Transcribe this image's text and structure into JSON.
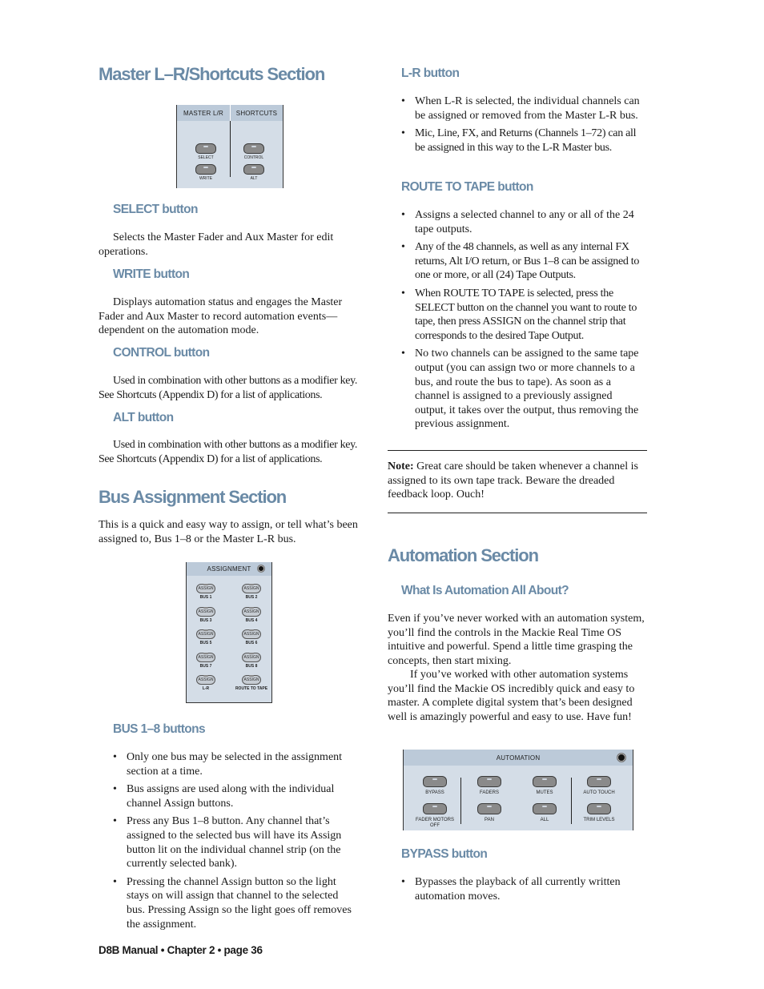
{
  "left": {
    "master_section": {
      "title": "Master L–R/Shortcuts Section",
      "panel": {
        "headers": [
          "MASTER L/R",
          "SHORTCUTS"
        ],
        "buttons": [
          "SELECT",
          "CONTROL",
          "WRITE",
          "ALT"
        ]
      },
      "subsections": [
        {
          "heading": "SELECT button",
          "text": "Selects the Master Fader and Aux Master for edit operations."
        },
        {
          "heading": "WRITE button",
          "text": "Displays automation status and engages the Master Fader and Aux Master to record automation events—dependent on the automation mode."
        },
        {
          "heading": "CONTROL button",
          "text": "Used in combination with other buttons as a modifier key. See Shortcuts (Appendix D) for a list of applications."
        },
        {
          "heading": "ALT button",
          "text": "Used in combination with other buttons as a modifier key. See Shortcuts (Appendix D) for a list of applications."
        }
      ]
    },
    "bus_section": {
      "title": "Bus Assignment Section",
      "intro": "This is a quick and easy way to assign, or tell what’s been assigned to, Bus 1–8 or the Master L-R bus.",
      "panel": {
        "header": "ASSIGNMENT",
        "button_text": "ASSIGN",
        "labels": [
          "BUS 1",
          "BUS 2",
          "BUS 3",
          "BUS 4",
          "BUS 5",
          "BUS 6",
          "BUS 7",
          "BUS 8",
          "L-R",
          "ROUTE TO TAPE"
        ]
      },
      "bus_heading": "BUS 1–8 buttons",
      "bus_bullets": [
        "Only one bus may be selected in the assignment section at a time.",
        "Bus assigns are used along with the individual channel Assign buttons.",
        "Press any Bus 1–8 button. Any channel that’s assigned to the selected bus will have its Assign button lit on the individual channel strip (on the currently selected bank).",
        "Pressing the channel Assign button so the light stays on will assign that channel to the selected bus. Pressing Assign so the light goes off removes the assignment."
      ]
    }
  },
  "right": {
    "lr_heading": "L-R button",
    "lr_bullets": [
      "When L-R is selected, the individual channels can be assigned or removed from the Master L-R bus.",
      "Mic, Line, FX, and Returns (Channels 1–72) can all be assigned in this way to the L-R Master bus."
    ],
    "rtt_heading": "ROUTE TO TAPE button",
    "rtt_bullets": [
      "Assigns a selected channel to any or all of the 24 tape outputs.",
      "Any of the 48 channels, as well as any internal FX returns, Alt I/O return, or Bus 1–8 can be assigned to one or more, or all (24) Tape Outputs.",
      "When ROUTE TO TAPE is selected, press the SELECT button on the channel you want to route to tape, then press ASSIGN on the channel strip that corresponds to the desired Tape Output.",
      "No two channels can be assigned to the same tape output (you can assign two or more channels to a bus, and route the bus to tape). As soon as a channel is assigned to a previously assigned output, it takes over the output, thus removing the previous assignment."
    ],
    "note_label": "Note:",
    "note_text": " Great care should be taken whenever a channel is assigned to its own tape track. Beware the dreaded feedback loop. Ouch!",
    "automation": {
      "title": "Automation Section",
      "sub_heading": "What Is Automation All About?",
      "para1": "Even if you’ve never worked with an automation system, you’ll find the controls in the Mackie Real Time OS intuitive and powerful. Spend a little time grasping the concepts, then start mixing.",
      "para2": "If you’ve worked with other automation systems you’ll find the Mackie OS incredibly quick and easy to master. A complete digital system that’s been designed well is amazingly powerful and easy to use. Have fun!",
      "panel": {
        "header": "AUTOMATION",
        "top_labels": [
          "BYPASS",
          "FADERS",
          "MUTES",
          "AUTO TOUCH"
        ],
        "bottom_labels": [
          "FADER MOTORS OFF",
          "PAN",
          "ALL",
          "TRIM LEVELS"
        ]
      },
      "bypass_heading": "BYPASS button",
      "bypass_bullets": [
        "Bypasses the playback of all currently written automation moves."
      ]
    }
  },
  "footer": "D8B Manual • Chapter 2 • page 36"
}
